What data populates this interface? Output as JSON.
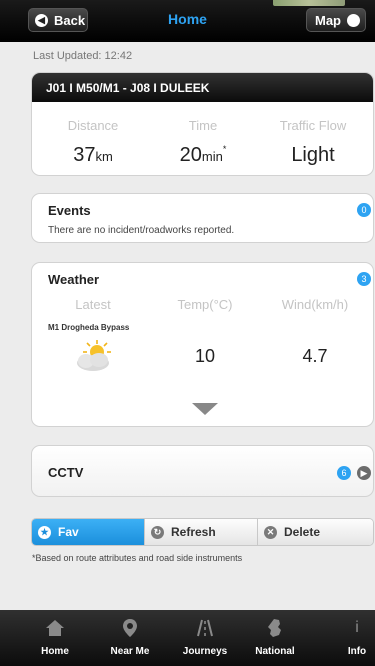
{
  "header": {
    "back_label": "Back",
    "title": "Home",
    "map_label": "Map"
  },
  "last_updated": "Last Updated: 12:42",
  "route": {
    "name": "J01 I M50/M1 - J08 I DULEEK",
    "distance_label": "Distance",
    "distance_value": "37",
    "distance_unit": "km",
    "time_label": "Time",
    "time_value": "20",
    "time_unit": "min",
    "time_mark": "*",
    "flow_label": "Traffic Flow",
    "flow_value": "Light"
  },
  "events": {
    "title": "Events",
    "count": "0",
    "message": "There are no incident/roadworks reported."
  },
  "weather": {
    "title": "Weather",
    "count": "3",
    "col_latest": "Latest",
    "col_temp": "Temp(°C)",
    "col_wind": "Wind(km/h)",
    "location": "M1 Drogheda Bypass",
    "icon": "partly-cloudy-icon",
    "temp": "10",
    "wind": "4.7"
  },
  "cctv": {
    "title": "CCTV",
    "count": "6"
  },
  "actions": {
    "fav": "Fav",
    "refresh": "Refresh",
    "delete": "Delete"
  },
  "footnote": "*Based on route attributes and road side instruments",
  "tabs": [
    {
      "label": "Home",
      "icon": "home-icon"
    },
    {
      "label": "Near Me",
      "icon": "location-pin-icon"
    },
    {
      "label": "Journeys",
      "icon": "road-icon"
    },
    {
      "label": "National",
      "icon": "ireland-map-icon"
    },
    {
      "label": "Info",
      "icon": "info-icon"
    }
  ],
  "colors": {
    "accent": "#2ea3f2",
    "fav_active": "#1b8fdc",
    "header_bg": "#000000"
  }
}
